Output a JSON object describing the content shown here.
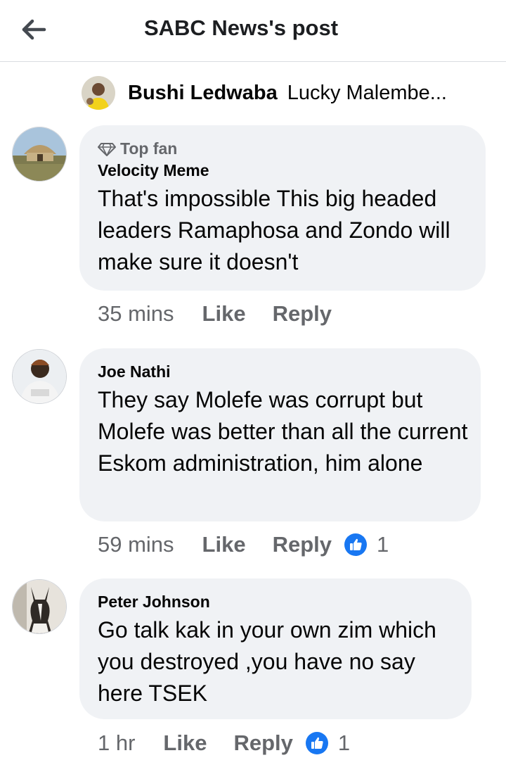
{
  "header": {
    "title": "SABC News's post"
  },
  "reply_preview": {
    "name": "Bushi Ledwaba",
    "snippet": "Lucky Malembe..."
  },
  "comments": [
    {
      "badge": "Top fan",
      "author": "Velocity Meme",
      "text": "That's impossible This big headed leaders Ramaphosa and Zondo will make sure it doesn't",
      "time": "35 mins",
      "like_label": "Like",
      "reply_label": "Reply"
    },
    {
      "author": "Joe Nathi",
      "text": "They say Molefe was corrupt but Molefe was better than all the current Eskom administration, him alone",
      "time": "59 mins",
      "like_label": "Like",
      "reply_label": "Reply",
      "reaction_count": "1"
    },
    {
      "author": "Peter Johnson",
      "text": "Go talk kak in your own zim which you destroyed ,you have no say here TSEK",
      "time": "1 hr",
      "like_label": "Like",
      "reply_label": "Reply",
      "reaction_count": "1"
    }
  ],
  "colors": {
    "bubble": "#f0f2f5",
    "meta_text": "#65676b",
    "like_blue": "#1877f2"
  },
  "icons": {
    "back": "arrow-left-icon",
    "top_fan": "diamond-icon",
    "reaction": "thumbs-up-icon"
  }
}
